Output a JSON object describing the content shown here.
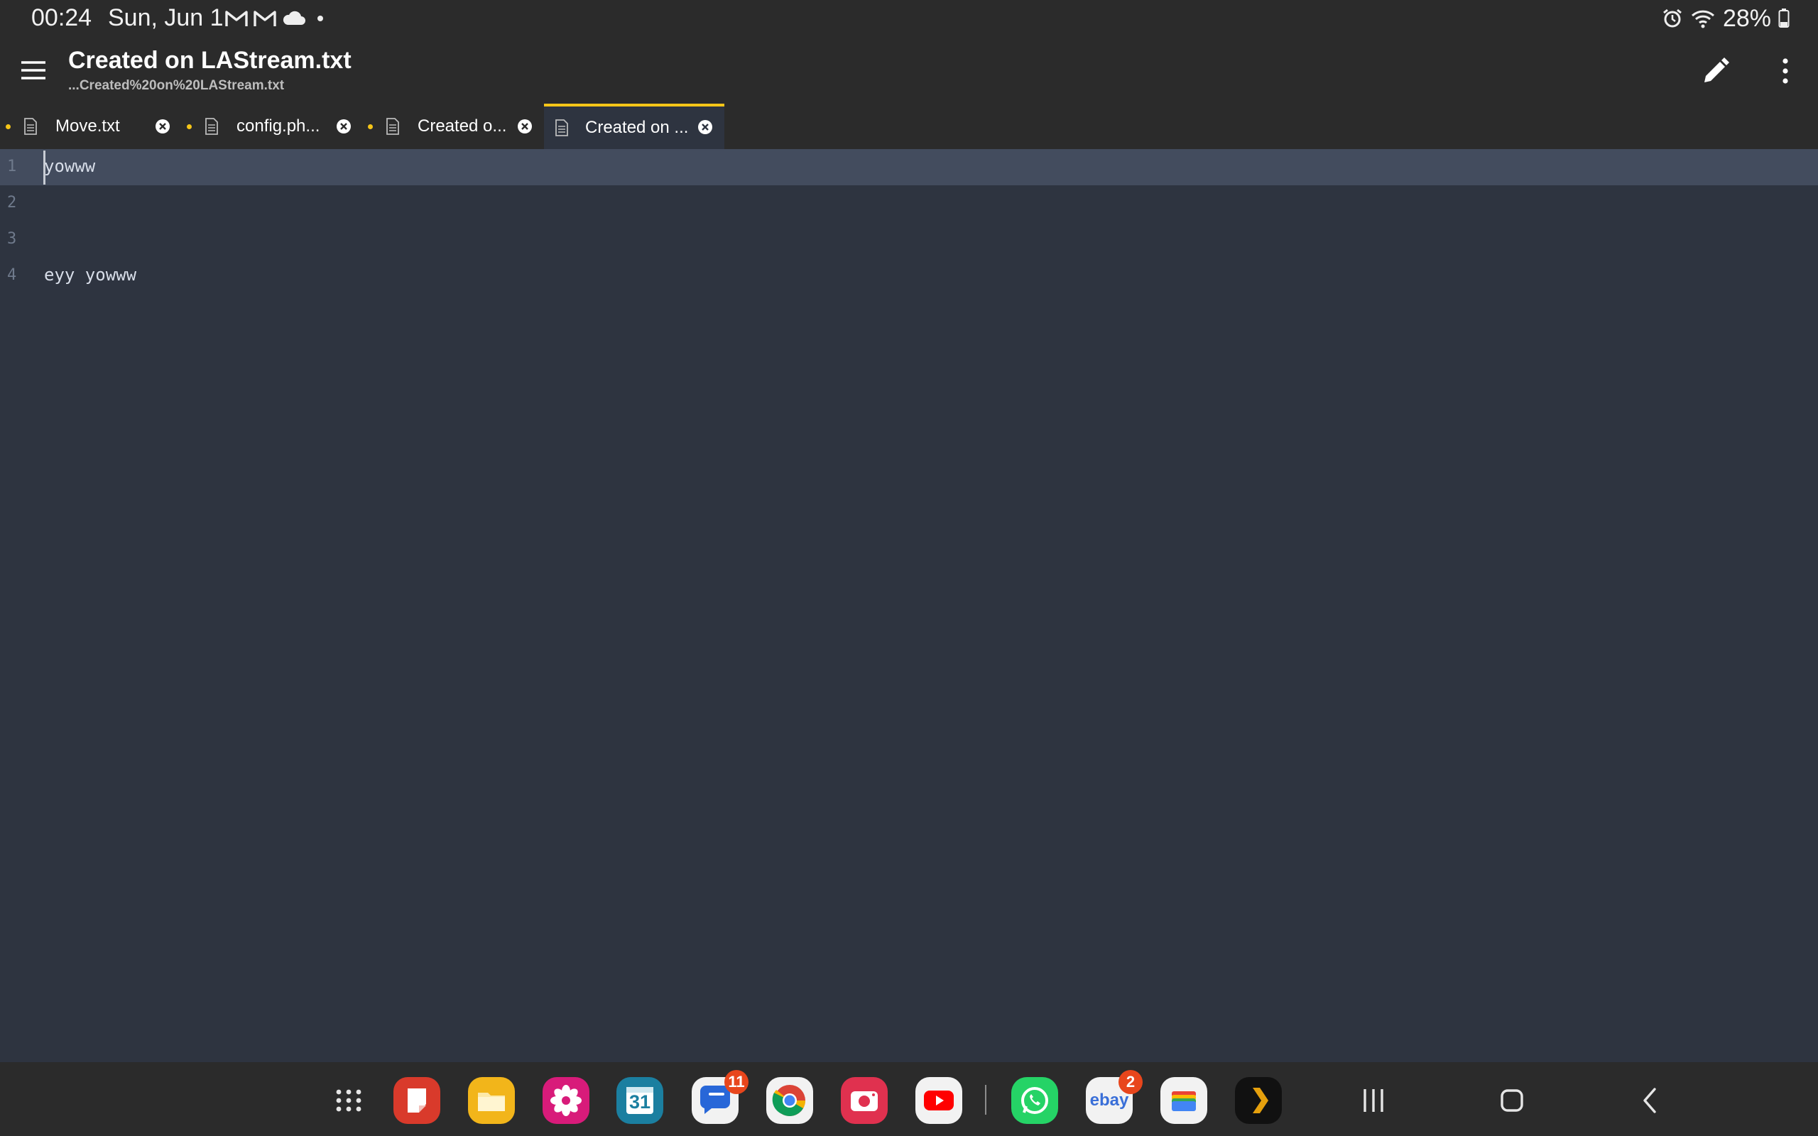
{
  "status_bar": {
    "time": "00:24",
    "date": "Sun, Jun 1",
    "notification_icons": [
      "gmail-icon",
      "gmail-icon",
      "cloud-icon",
      "dot-icon"
    ],
    "right_icons": [
      "alarm-icon",
      "wifi-icon",
      "battery-icon"
    ],
    "battery": "28%"
  },
  "app_bar": {
    "title": "Created on LAStream.txt",
    "subtitle": "...Created%20on%20LAStream.txt"
  },
  "tabs": [
    {
      "label": "Move.txt",
      "modified": true,
      "active": false
    },
    {
      "label": "config.ph...",
      "modified": true,
      "active": false
    },
    {
      "label": "Created o...",
      "modified": true,
      "active": false
    },
    {
      "label": "Created on ...",
      "modified": false,
      "active": true
    }
  ],
  "editor": {
    "lines": [
      {
        "number": "1",
        "text": "yowww"
      },
      {
        "number": "2",
        "text": ""
      },
      {
        "number": "3",
        "text": ""
      },
      {
        "number": "4",
        "text": "eyy yowww"
      }
    ],
    "current_line": 1
  },
  "dock": {
    "apps": [
      {
        "name": "app-drawer"
      },
      {
        "name": "samsung-notes"
      },
      {
        "name": "my-files"
      },
      {
        "name": "galaxy-store-flower"
      },
      {
        "name": "calendar",
        "label": "31"
      },
      {
        "name": "messages",
        "badge": "11"
      },
      {
        "name": "chrome"
      },
      {
        "name": "camera"
      },
      {
        "name": "youtube"
      },
      {
        "name": "whatsapp"
      },
      {
        "name": "ebay",
        "label": "ebay",
        "badge": "2"
      },
      {
        "name": "wallet"
      },
      {
        "name": "plex"
      }
    ]
  },
  "colors": {
    "accent": "#f5c518",
    "editor_bg": "#2e3440",
    "bar_bg": "#2b2b2b",
    "current_line": "#434c5e",
    "badge": "#e8461c"
  }
}
